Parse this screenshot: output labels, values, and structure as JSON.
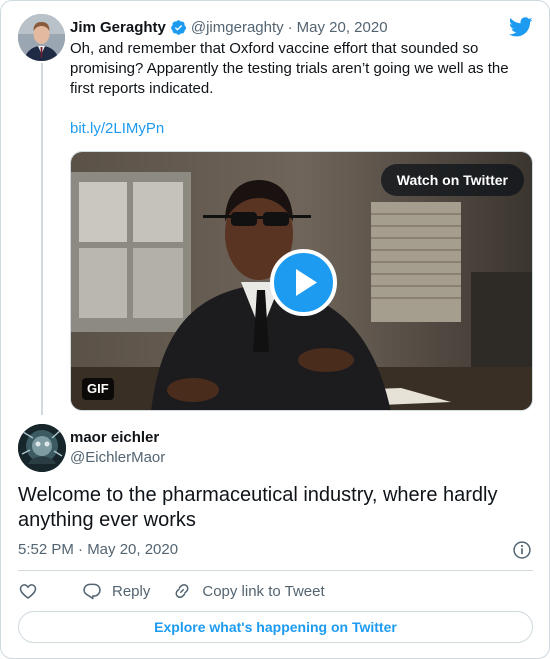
{
  "parent_tweet": {
    "author_name": "Jim Geraghty",
    "handle": "@jimgeraghty",
    "separator": "·",
    "date": "May 20, 2020",
    "text": "Oh, and remember that Oxford vaccine effort that sounded so promising? Apparently the testing trials aren’t going we well as the first reports indicated.",
    "link": "bit.ly/2LIMyPn",
    "media": {
      "watch_label": "Watch on Twitter",
      "badge": "GIF"
    }
  },
  "reply_tweet": {
    "author_name": "maor eichler",
    "handle": "@EichlerMaor",
    "text": "Welcome to the pharmaceutical industry, where hardly anything ever works",
    "timestamp": "5:52 PM · May 20, 2020"
  },
  "actions": {
    "reply_label": "Reply",
    "copy_link_label": "Copy link to Tweet"
  },
  "footer": {
    "explore_label": "Explore what's happening on Twitter"
  },
  "colors": {
    "accent": "#1d9bf0",
    "text": "#0f1419",
    "secondary_text": "#536471",
    "border": "#cfd9de"
  },
  "icons": [
    "twitter-logo-icon",
    "verified-badge-icon",
    "play-icon",
    "info-icon",
    "heart-icon",
    "reply-icon",
    "link-icon"
  ]
}
